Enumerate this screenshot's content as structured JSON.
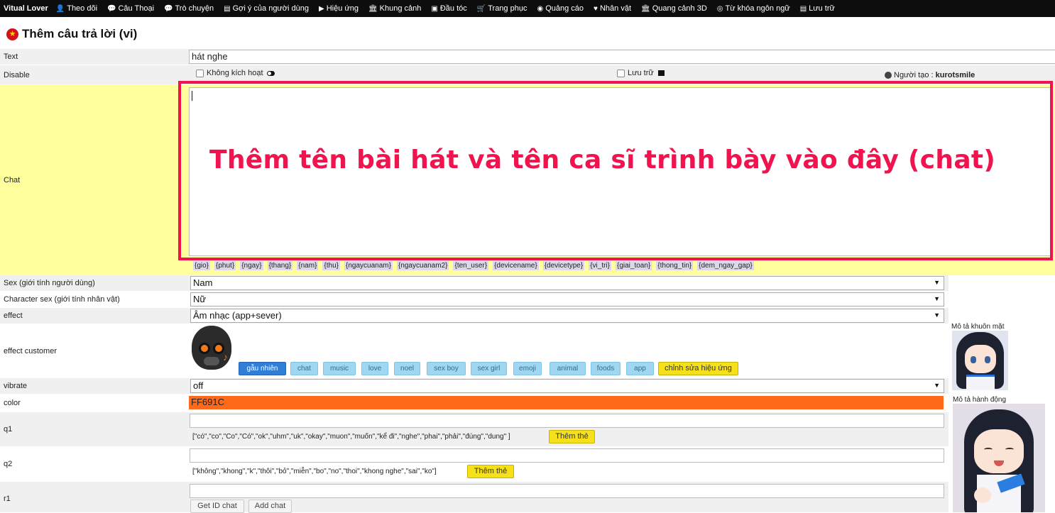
{
  "nav": {
    "brand": "Vitual Lover",
    "items": [
      {
        "icon": "user-icon",
        "glyph": "👤",
        "label": "Theo dõi"
      },
      {
        "icon": "comment-icon",
        "glyph": "💬",
        "label": "Câu Thoại"
      },
      {
        "icon": "comments-icon",
        "glyph": "💬",
        "label": "Trò chuyện"
      },
      {
        "icon": "list-icon",
        "glyph": "▤",
        "label": "Gợi ý của người dùng"
      },
      {
        "icon": "play-circle-icon",
        "glyph": "▶",
        "label": "Hiệu ứng"
      },
      {
        "icon": "bank-icon",
        "glyph": "🏛",
        "label": "Khung cảnh"
      },
      {
        "icon": "hair-icon",
        "glyph": "▣",
        "label": "Đầu tóc"
      },
      {
        "icon": "cart-icon",
        "glyph": "🛒",
        "label": "Trang phục"
      },
      {
        "icon": "ad-icon",
        "glyph": "◉",
        "label": "Quảng cáo"
      },
      {
        "icon": "heart-icon",
        "glyph": "♥",
        "label": "Nhân vật"
      },
      {
        "icon": "bank-3d-icon",
        "glyph": "🏛",
        "label": "Quang cảnh 3D"
      },
      {
        "icon": "target-icon",
        "glyph": "◎",
        "label": "Từ khóa ngôn ngữ"
      },
      {
        "icon": "archive-icon",
        "glyph": "▤",
        "label": "Lưu trữ"
      }
    ]
  },
  "page": {
    "title": "Thêm câu trả lời (vi)"
  },
  "form": {
    "text_label": "Text",
    "text_value": "hát nghe",
    "disable_label": "Disable",
    "disable_checkbox": "Không kích hoạt",
    "archive_checkbox": "Lưu trữ",
    "creator_label": "Người tạo :",
    "creator_name": "kurotsmile",
    "chat_label": "Chat",
    "tags": [
      "{gio}",
      "{phut}",
      "{ngay}",
      "{thang}",
      "{nam}",
      "{thu}",
      "{ngaycuanam}",
      "{ngaycuanam2}",
      "{ten_user}",
      "{devicename}",
      "{devicetype}",
      "{vi_tri}",
      "{giai_toan}",
      "{thong_tin}",
      "{dem_ngay_gap}"
    ],
    "sex_label": "Sex (giới tính người dùng)",
    "sex_value": "Nam",
    "char_sex_label": "Character sex (giới tính nhân vật)",
    "char_sex_value": "Nữ",
    "effect_label": "effect",
    "effect_value": "Âm nhạc (app+sever)",
    "effect_customer_label": "effect customer",
    "effect_buttons": [
      "gẫu nhiên",
      "chat",
      "music",
      "love",
      "noel",
      "sex boy",
      "sex girl",
      "emoji",
      "animal",
      "foods",
      "app"
    ],
    "edit_effect_button": "chỉnh sửa hiệu ứng",
    "vibrate_label": "vibrate",
    "vibrate_value": "off",
    "color_label": "color",
    "color_value": "FF691C",
    "color_hex": "#FF691C",
    "q1_label": "q1",
    "q1_hint": "[\"có\",\"co\",\"Co\",\"Có\",\"ok\",\"uhm\",\"uk\",\"okay\",\"muon\",\"muốn\",\"kể đi\",\"nghe\",\"phai\",\"phải\",\"đúng\",\"dung\" ]",
    "q2_label": "q2",
    "q2_hint": "[\"không\",\"khong\",\"k\",\"thôi\",\"bỏ\",\"miễn\",\"bo\",\"no\",\"thoi\",\"khong nghe\",\"sai\",\"ko\"]",
    "add_tag_button": "Thêm thẻ",
    "r1_label": "r1",
    "get_id_button": "Get ID chat",
    "add_chat_button": "Add chat"
  },
  "annotation": {
    "text": "Thêm tên bài hát và tên ca sĩ trình bày vào đây (chat)",
    "color": "#F0134D"
  },
  "side": {
    "face_label": "Mô tả khuôn mặt",
    "action_label": "Mô tả hành động"
  }
}
